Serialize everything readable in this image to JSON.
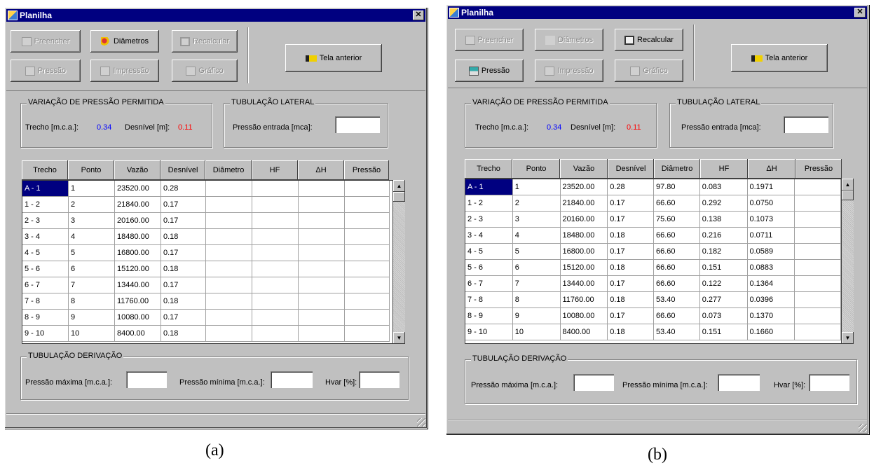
{
  "captions": {
    "a": "(a)",
    "b": "(b)"
  },
  "windows": [
    {
      "title": "Planilha",
      "close_glyph": "✕",
      "buttons": {
        "preencher": "Preencher",
        "diametros": "Diâmetros",
        "recalcular": "Recalcular",
        "pressao": "Pressão",
        "impressao": "Impressão",
        "grafico": "Gráfico",
        "tela_anterior": "Tela anterior"
      },
      "variacao": {
        "title": "VARIAÇÃO DE PRESSÃO PERMITIDA",
        "trecho_label": "Trecho [m.c.a.]:",
        "trecho_value": "0.34",
        "desnivel_label": "Desnível [m]:",
        "desnivel_value": "0.11"
      },
      "lateral": {
        "title": "TUBULAÇÃO LATERAL",
        "pressao_label": "Pressão entrada [mca]:",
        "pressao_value": ""
      },
      "derivacao": {
        "title": "TUBULAÇÃO DERIVAÇÃO",
        "pmax_label": "Pressão máxima [m.c.a.]:",
        "pmax_value": "",
        "pmin_label": "Pressão mínima [m.c.a.]:",
        "pmin_value": "",
        "hvar_label": "Hvar [%]:",
        "hvar_value": ""
      },
      "table": {
        "columns": [
          "Trecho",
          "Ponto",
          "Vazão",
          "Desnível",
          "Diâmetro",
          "HF",
          "ΔH",
          "Pressão"
        ],
        "rows": [
          [
            "A - 1",
            "1",
            "23520.00",
            "0.28",
            "",
            "",
            "",
            ""
          ],
          [
            "1 - 2",
            "2",
            "21840.00",
            "0.17",
            "",
            "",
            "",
            ""
          ],
          [
            "2 - 3",
            "3",
            "20160.00",
            "0.17",
            "",
            "",
            "",
            ""
          ],
          [
            "3 - 4",
            "4",
            "18480.00",
            "0.18",
            "",
            "",
            "",
            ""
          ],
          [
            "4 - 5",
            "5",
            "16800.00",
            "0.17",
            "",
            "",
            "",
            ""
          ],
          [
            "5 - 6",
            "6",
            "15120.00",
            "0.18",
            "",
            "",
            "",
            ""
          ],
          [
            "6 - 7",
            "7",
            "13440.00",
            "0.17",
            "",
            "",
            "",
            ""
          ],
          [
            "7 - 8",
            "8",
            "11760.00",
            "0.18",
            "",
            "",
            "",
            ""
          ],
          [
            "8 - 9",
            "9",
            "10080.00",
            "0.17",
            "",
            "",
            "",
            ""
          ],
          [
            "9 - 10",
            "10",
            "8400.00",
            "0.18",
            "",
            "",
            "",
            ""
          ]
        ]
      },
      "colors": {
        "trecho_value": "#0000ff",
        "desnivel_value": "#ff0000"
      }
    },
    {
      "title": "Planilha",
      "close_glyph": "✕",
      "buttons": {
        "preencher": "Preencher",
        "diametros": "Diâmetros",
        "recalcular": "Recalcular",
        "pressao": "Pressão",
        "impressao": "Impressão",
        "grafico": "Gráfico",
        "tela_anterior": "Tela anterior"
      },
      "variacao": {
        "title": "VARIAÇÃO DE PRESSÃO PERMITIDA",
        "trecho_label": "Trecho [m.c.a.]:",
        "trecho_value": "0.34",
        "desnivel_label": "Desnível [m]:",
        "desnivel_value": "0.11"
      },
      "lateral": {
        "title": "TUBULAÇÃO LATERAL",
        "pressao_label": "Pressão entrada [mca]:",
        "pressao_value": ""
      },
      "derivacao": {
        "title": "TUBULAÇÃO DERIVAÇÃO",
        "pmax_label": "Pressão máxima [m.c.a.]:",
        "pmax_value": "",
        "pmin_label": "Pressão mínima [m.c.a.]:",
        "pmin_value": "",
        "hvar_label": "Hvar [%]:",
        "hvar_value": ""
      },
      "table": {
        "columns": [
          "Trecho",
          "Ponto",
          "Vazão",
          "Desnível",
          "Diâmetro",
          "HF",
          "ΔH",
          "Pressão"
        ],
        "rows": [
          [
            "A - 1",
            "1",
            "23520.00",
            "0.28",
            "97.80",
            "0.083",
            "0.1971",
            ""
          ],
          [
            "1 - 2",
            "2",
            "21840.00",
            "0.17",
            "66.60",
            "0.292",
            "0.0750",
            ""
          ],
          [
            "2 - 3",
            "3",
            "20160.00",
            "0.17",
            "75.60",
            "0.138",
            "0.1073",
            ""
          ],
          [
            "3 - 4",
            "4",
            "18480.00",
            "0.18",
            "66.60",
            "0.216",
            "0.0711",
            ""
          ],
          [
            "4 - 5",
            "5",
            "16800.00",
            "0.17",
            "66.60",
            "0.182",
            "0.0589",
            ""
          ],
          [
            "5 - 6",
            "6",
            "15120.00",
            "0.18",
            "66.60",
            "0.151",
            "0.0883",
            ""
          ],
          [
            "6 - 7",
            "7",
            "13440.00",
            "0.17",
            "66.60",
            "0.122",
            "0.1364",
            ""
          ],
          [
            "7 - 8",
            "8",
            "11760.00",
            "0.18",
            "53.40",
            "0.277",
            "0.0396",
            ""
          ],
          [
            "8 - 9",
            "9",
            "10080.00",
            "0.17",
            "66.60",
            "0.073",
            "0.1370",
            ""
          ],
          [
            "9 - 10",
            "10",
            "8400.00",
            "0.18",
            "53.40",
            "0.151",
            "0.1660",
            ""
          ]
        ]
      },
      "colors": {
        "trecho_value": "#0000ff",
        "desnivel_value": "#ff0000"
      }
    }
  ],
  "states": {
    "a": {
      "preencher": "disabled",
      "diametros": "enabled",
      "recalcular": "disabled",
      "pressao": "disabled",
      "impressao": "disabled",
      "grafico": "disabled",
      "tela_anterior": "enabled"
    },
    "b": {
      "preencher": "disabled",
      "diametros": "disabled",
      "recalcular": "enabled",
      "pressao": "enabled",
      "impressao": "disabled",
      "grafico": "disabled",
      "tela_anterior": "enabled"
    }
  }
}
